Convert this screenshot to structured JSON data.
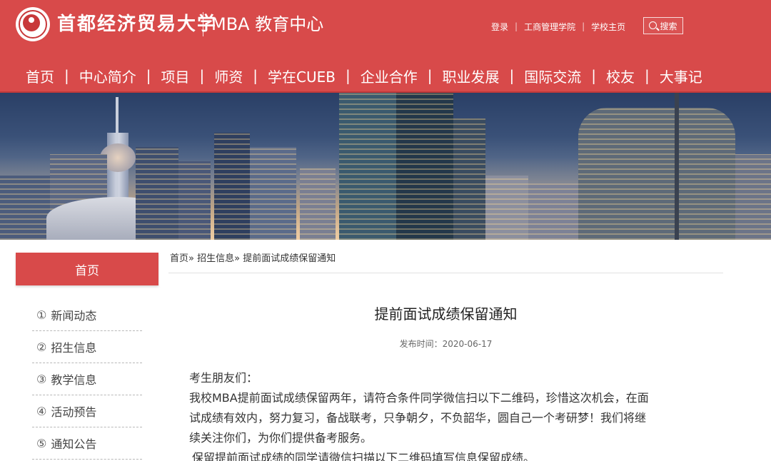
{
  "header": {
    "university_name": "首都经济贸易大学",
    "site_title": "MBA 教育中心",
    "top_links": [
      "登录",
      "工商管理学院",
      "学校主页"
    ],
    "search_label": "搜索",
    "nav": [
      "首页",
      "中心简介",
      "项目",
      "师资",
      "学在CUEB",
      "企业合作",
      "职业发展",
      "国际交流",
      "校友",
      "大事记"
    ]
  },
  "sidebar": {
    "home_label": "首页",
    "items": [
      {
        "num": "①",
        "label": "新闻动态"
      },
      {
        "num": "②",
        "label": "招生信息"
      },
      {
        "num": "③",
        "label": "教学信息"
      },
      {
        "num": "④",
        "label": "活动预告"
      },
      {
        "num": "⑤",
        "label": "通知公告"
      }
    ]
  },
  "breadcrumb": {
    "home": "首页",
    "sep": "»",
    "section": "招生信息",
    "current": "提前面试成绩保留通知"
  },
  "article": {
    "title": "提前面试成绩保留通知",
    "publish_label": "发布时间：",
    "publish_date": "2020-06-17",
    "greeting": "考生朋友们：",
    "paragraph1_line1": "我校MBA提前面试成绩保留两年，请符合条件同学微信扫以下二维码，珍惜这次机会，在面",
    "paragraph1_line2": "试成绩有效内，努力复习，备战联考，只争朝夕，不负韶华，圆自己一个考研梦！我们将继",
    "paragraph1_line3": "续关注你们，为你们提供备考服务。",
    "paragraph2": "保留提前面试成绩的同学请微信扫描以下二维码填写信息保留成绩。"
  },
  "colors": {
    "brand_red": "#d84a4a",
    "text": "#333333"
  }
}
